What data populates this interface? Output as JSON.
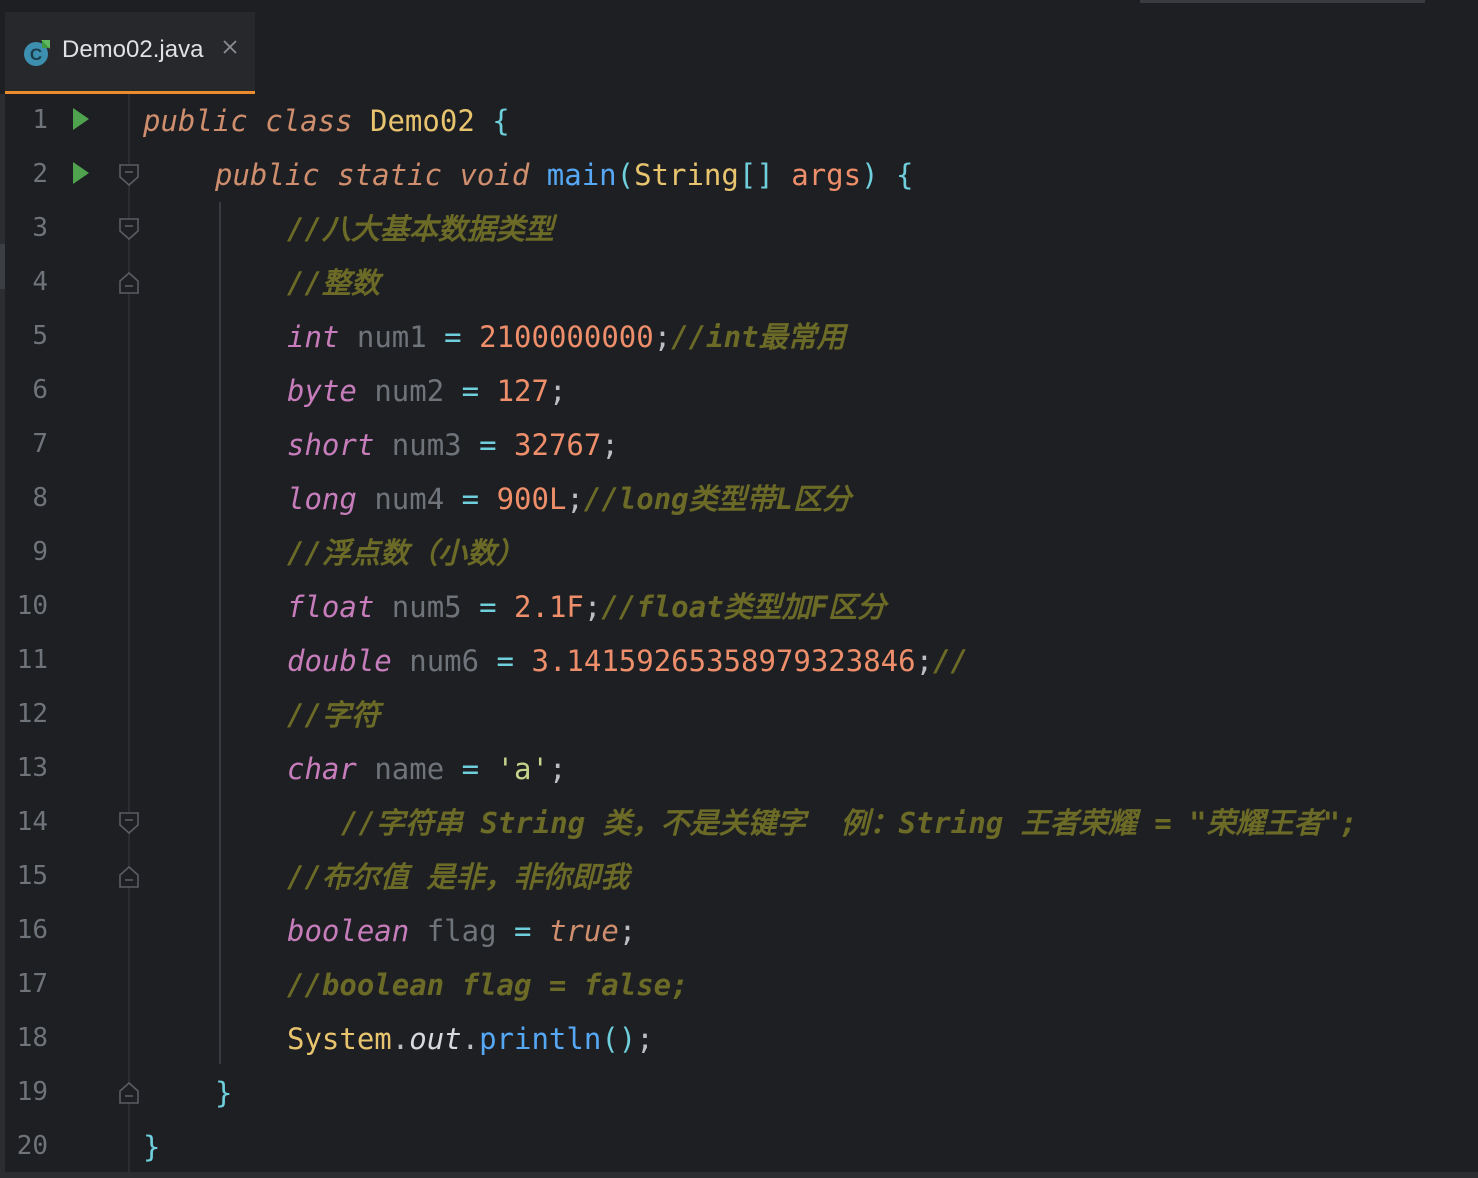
{
  "tab": {
    "label": "Demo02.java",
    "icon": "java-class-icon",
    "active_color": "#ec8a2e"
  },
  "lines": [
    {
      "num": "1",
      "tokens": [
        [
          "kw",
          "public"
        ],
        [
          "pun",
          " "
        ],
        [
          "kw",
          "class"
        ],
        [
          "pun",
          " "
        ],
        [
          "cls",
          "Demo02"
        ],
        [
          "pun",
          " "
        ],
        [
          "brk",
          "{"
        ]
      ]
    },
    {
      "num": "2",
      "tokens": [
        [
          "kw",
          "public"
        ],
        [
          "pun",
          " "
        ],
        [
          "kw",
          "static"
        ],
        [
          "pun",
          " "
        ],
        [
          "kw",
          "void"
        ],
        [
          "pun",
          " "
        ],
        [
          "fn",
          "main"
        ],
        [
          "brk",
          "("
        ],
        [
          "cls",
          "String"
        ],
        [
          "brk",
          "[]"
        ],
        [
          "pun",
          " "
        ],
        [
          "num",
          "args"
        ],
        [
          "brk",
          ")"
        ],
        [
          "pun",
          " "
        ],
        [
          "brk",
          "{"
        ]
      ]
    },
    {
      "num": "3",
      "tokens": [
        [
          "cmt",
          "//八大基本数据类型"
        ]
      ]
    },
    {
      "num": "4",
      "tokens": [
        [
          "cmt",
          "//整数"
        ]
      ]
    },
    {
      "num": "5",
      "tokens": [
        [
          "typ",
          "int"
        ],
        [
          "pun",
          " "
        ],
        [
          "var",
          "num1"
        ],
        [
          "pun",
          " "
        ],
        [
          "op",
          "="
        ],
        [
          "pun",
          " "
        ],
        [
          "num",
          "2100000000"
        ],
        [
          "pun",
          ";"
        ],
        [
          "cmt",
          "//int最常用"
        ]
      ]
    },
    {
      "num": "6",
      "tokens": [
        [
          "typ",
          "byte"
        ],
        [
          "pun",
          " "
        ],
        [
          "var",
          "num2"
        ],
        [
          "pun",
          " "
        ],
        [
          "op",
          "="
        ],
        [
          "pun",
          " "
        ],
        [
          "num",
          "127"
        ],
        [
          "pun",
          ";"
        ]
      ]
    },
    {
      "num": "7",
      "tokens": [
        [
          "typ",
          "short"
        ],
        [
          "pun",
          " "
        ],
        [
          "var",
          "num3"
        ],
        [
          "pun",
          " "
        ],
        [
          "op",
          "="
        ],
        [
          "pun",
          " "
        ],
        [
          "num",
          "32767"
        ],
        [
          "pun",
          ";"
        ]
      ]
    },
    {
      "num": "8",
      "tokens": [
        [
          "typ",
          "long"
        ],
        [
          "pun",
          " "
        ],
        [
          "var",
          "num4"
        ],
        [
          "pun",
          " "
        ],
        [
          "op",
          "="
        ],
        [
          "pun",
          " "
        ],
        [
          "num",
          "900L"
        ],
        [
          "pun",
          ";"
        ],
        [
          "cmt",
          "//long类型带L区分"
        ]
      ]
    },
    {
      "num": "9",
      "tokens": [
        [
          "cmt",
          "//浮点数（小数）"
        ]
      ]
    },
    {
      "num": "10",
      "tokens": [
        [
          "typ",
          "float"
        ],
        [
          "pun",
          " "
        ],
        [
          "var",
          "num5"
        ],
        [
          "pun",
          " "
        ],
        [
          "op",
          "="
        ],
        [
          "pun",
          " "
        ],
        [
          "num",
          "2.1F"
        ],
        [
          "pun",
          ";"
        ],
        [
          "cmt",
          "//float类型加F区分"
        ]
      ]
    },
    {
      "num": "11",
      "tokens": [
        [
          "typ",
          "double"
        ],
        [
          "pun",
          " "
        ],
        [
          "var",
          "num6"
        ],
        [
          "pun",
          " "
        ],
        [
          "op",
          "="
        ],
        [
          "pun",
          " "
        ],
        [
          "num",
          "3.14159265358979323846"
        ],
        [
          "pun",
          ";"
        ],
        [
          "cmt",
          "//"
        ]
      ]
    },
    {
      "num": "12",
      "tokens": [
        [
          "cmt",
          "//字符"
        ]
      ]
    },
    {
      "num": "13",
      "tokens": [
        [
          "typ",
          "char"
        ],
        [
          "pun",
          " "
        ],
        [
          "var",
          "name"
        ],
        [
          "pun",
          " "
        ],
        [
          "op",
          "="
        ],
        [
          "pun",
          " "
        ],
        [
          "str",
          "'a'"
        ],
        [
          "pun",
          ";"
        ]
      ]
    },
    {
      "num": "14",
      "tokens": [
        [
          "cmt",
          "//字符串 String 类，不是关键字  例：String 王者荣耀 = \"荣耀王者\";"
        ]
      ]
    },
    {
      "num": "15",
      "tokens": [
        [
          "cmt",
          "//布尔值 是非，非你即我"
        ]
      ]
    },
    {
      "num": "16",
      "tokens": [
        [
          "typ",
          "boolean"
        ],
        [
          "pun",
          " "
        ],
        [
          "var",
          "flag"
        ],
        [
          "pun",
          " "
        ],
        [
          "op",
          "="
        ],
        [
          "pun",
          " "
        ],
        [
          "kwtrue",
          "true"
        ],
        [
          "pun",
          ";"
        ]
      ]
    },
    {
      "num": "17",
      "tokens": [
        [
          "cmt",
          "//boolean flag = false;"
        ]
      ]
    },
    {
      "num": "18",
      "tokens": [
        [
          "cls",
          "System"
        ],
        [
          "pun",
          "."
        ],
        [
          "fld",
          "out"
        ],
        [
          "pun",
          "."
        ],
        [
          "fn",
          "println"
        ],
        [
          "brk",
          "()"
        ],
        [
          "pun",
          ";"
        ]
      ]
    },
    {
      "num": "19",
      "tokens": [
        [
          "brk",
          "}"
        ]
      ]
    },
    {
      "num": "20",
      "tokens": [
        [
          "brk",
          "}"
        ]
      ]
    }
  ],
  "colors": {
    "background": "#1e1f22",
    "keyword": "#cf8e6d",
    "class": "#e8c46f",
    "method": "#56a8f5",
    "type": "#c77dbb",
    "number": "#ee8e6a",
    "comment": "#6b6a26",
    "line_number": "#6f737a",
    "run_icon": "#4fa34f"
  }
}
